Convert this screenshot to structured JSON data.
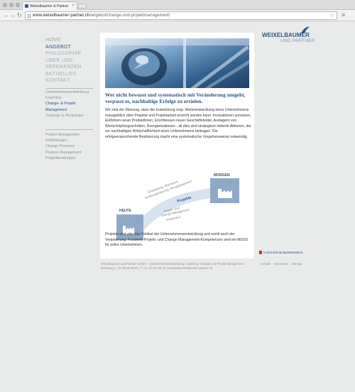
{
  "browser": {
    "tab_title": "Weixelbaumer & Partner",
    "url_host": "www.weixelbaumer-partner.ch",
    "url_path": "/angebot/change-und-projektmanagement/"
  },
  "main_nav": [
    {
      "label": "HOME",
      "active": false
    },
    {
      "label": "ANGEBOT",
      "active": true
    },
    {
      "label": "PHILOSOPHIE",
      "active": false
    },
    {
      "label": "ÜBER UNS",
      "active": false
    },
    {
      "label": "REFERENZEN",
      "active": false
    },
    {
      "label": "AKTUELLES",
      "active": false
    },
    {
      "label": "KONTAKT",
      "active": false
    }
  ],
  "sub_nav_1": [
    {
      "label": "Unternehmensentwicklung",
      "active": false
    },
    {
      "label": "Coaching",
      "active": false
    },
    {
      "label": "Change- & Projekt",
      "active": true
    },
    {
      "label": "Management",
      "active": true
    },
    {
      "label": "Trainings & Workshops",
      "active": false
    }
  ],
  "sub_nav_2": [
    {
      "label": "Projekt Management"
    },
    {
      "label": "Einführungen"
    },
    {
      "label": "Change Prozesse"
    },
    {
      "label": "Prozess Management"
    },
    {
      "label": "Projektberatungen"
    }
  ],
  "content": {
    "headline": "Wer nicht bewusst und systematisch mit Veränderung umgeht, verpasst es, nachhaltige Erfolge zu erzielen.",
    "intro": "Wir sind der Meinung, dass die Entwicklung resp. Weiterentwicklung eines Unternehmens massgeblich über Projekte und Projektarbeit erreicht werden kann. Innovationen umsetzen, Einführen neuer Produktlinien, Erschliessen neuer Geschäftsfelder, Auslagern von Wertschöpfungsschritten, Reorganisationen - all dies sind strategisch initiierte Aktionen, die zur nachhaltigen Wirtschaftlichkeit eines Unternehmens beitragen. Die erfolgversprechende Realisierung macht eine systematische Vorgehensweise notwendig.",
    "closing": "Projekte sind also das Vehikel der Unternehmensentwicklung und somit auch der Veränderung. Fundierte Projekt- und Change Management-Kompetenzen sind ein MUSS für jedes Unternehmen."
  },
  "diagram": {
    "heute": "HEUTE",
    "morgen": "MORGEN",
    "arrow_label": "Projekte",
    "upper_text_1": "Entwicklung, Wachstum,",
    "upper_text_2": "Kostenoptimierung, Reorganisationen",
    "lower_text_1": "Projekt- und",
    "lower_text_2": "Change-Management",
    "lower_text_3": "Kompetenz"
  },
  "logo": {
    "line1": "WEIXELBAUMER",
    "line2": "UND PARTNER"
  },
  "presentation_link": "Unternehmenspräsentation",
  "footer": {
    "line1": "Weixelbaumer und Partner GmbH – Unternehmensentwicklung, Coaching, Change und Projekt Management",
    "line2": "Brühlweg 1, CH-8049 Zürich, T +41 43 311 08 70, kontakt@weixelbaumer-partner.ch",
    "links": [
      "Kontakt",
      "Impressum",
      "Sitemap"
    ]
  },
  "colors": {
    "accent": "#2c5587",
    "nav_inactive": "#a6abb0",
    "background": "#e9eaea",
    "diagram_box": "#8ea9c7"
  }
}
